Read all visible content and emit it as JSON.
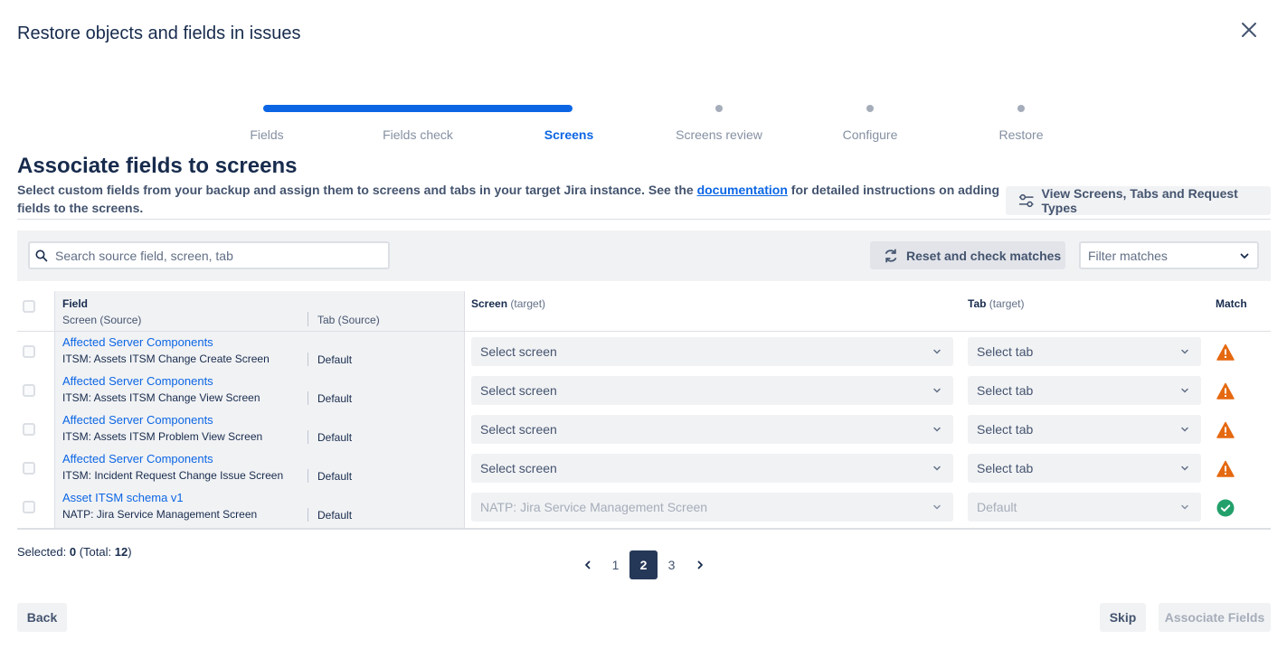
{
  "modal": {
    "title": "Restore objects and fields in issues"
  },
  "stepper": {
    "progress": 0.5,
    "steps": [
      {
        "label": "Fields",
        "state": "done"
      },
      {
        "label": "Fields check",
        "state": "done"
      },
      {
        "label": "Screens",
        "state": "current"
      },
      {
        "label": "Screens review",
        "state": "pending"
      },
      {
        "label": "Configure",
        "state": "pending"
      },
      {
        "label": "Restore",
        "state": "pending"
      }
    ]
  },
  "section": {
    "title": "Associate fields to screens",
    "desc_before": "Select custom fields from your backup and assign them to screens and tabs in your target Jira instance. See the ",
    "desc_link": "documentation",
    "desc_after": " for detailed instructions on adding fields to the screens.",
    "view_button": "View Screens, Tabs and Request Types"
  },
  "toolbar": {
    "search_placeholder": "Search source field, screen, tab",
    "reset_button": "Reset and check matches",
    "filter_placeholder": "Filter matches"
  },
  "table": {
    "headers": {
      "field": "Field",
      "screen_source": "Screen (Source)",
      "tab_source": "Tab (Source)",
      "screen_target": "Screen",
      "screen_target_note": "(target)",
      "tab_target": "Tab",
      "tab_target_note": "(target)",
      "match": "Match"
    },
    "rows": [
      {
        "field": "Affected Server Components",
        "screen_source": "ITSM: Assets ITSM Change Create Screen",
        "tab_source": "Default",
        "screen_target": "Select screen",
        "tab_target": "Select tab",
        "match": "warning"
      },
      {
        "field": "Affected Server Components",
        "screen_source": "ITSM: Assets ITSM Change View Screen",
        "tab_source": "Default",
        "screen_target": "Select screen",
        "tab_target": "Select tab",
        "match": "warning"
      },
      {
        "field": "Affected Server Components",
        "screen_source": "ITSM: Assets ITSM Problem View Screen",
        "tab_source": "Default",
        "screen_target": "Select screen",
        "tab_target": "Select tab",
        "match": "warning"
      },
      {
        "field": "Affected Server Components",
        "screen_source": "ITSM: Incident Request Change Issue Screen",
        "tab_source": "Default",
        "screen_target": "Select screen",
        "tab_target": "Select tab",
        "match": "warning"
      },
      {
        "field": "Asset ITSM schema v1",
        "screen_source": "NATP: Jira Service Management Screen",
        "tab_source": "Default",
        "screen_target": "NATP: Jira Service Management Screen",
        "tab_target": "Default",
        "match": "success"
      }
    ]
  },
  "selection": {
    "label": "Selected:",
    "count": "0",
    "total_label": "(Total:",
    "total": "12",
    "close": ")"
  },
  "pagination": {
    "pages": [
      "1",
      "2",
      "3"
    ],
    "current": "2"
  },
  "footer": {
    "back": "Back",
    "skip": "Skip",
    "associate": "Associate Fields"
  },
  "colors": {
    "primary": "#0c66e4",
    "warning": "#e56910",
    "success": "#22a06b",
    "pagination_current": "#253858"
  }
}
